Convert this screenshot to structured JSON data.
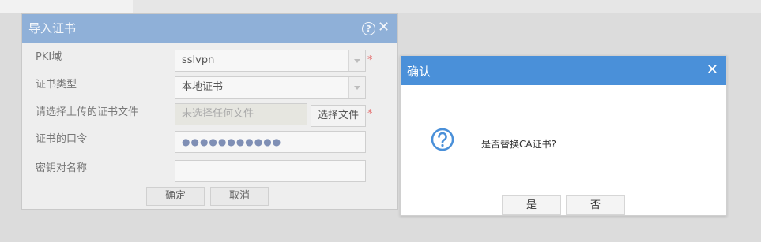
{
  "import_dialog": {
    "title": "导入证书",
    "help_icon": "question-circle-icon",
    "close_icon": "close-icon",
    "labels": {
      "pki_domain": "PKI域",
      "cert_type": "证书类型",
      "upload_file": "请选择上传的证书文件",
      "cert_password": "证书的口令",
      "key_pair_name": "密钥对名称"
    },
    "pki_domain_value": "sslvpn",
    "cert_type_value": "本地证书",
    "file_placeholder": "未选择任何文件",
    "choose_file_label": "选择文件",
    "password_mask": "●●●●●●●●●●●",
    "key_pair_value": "",
    "required_mark": "*",
    "ok_label": "确定",
    "cancel_label": "取消"
  },
  "confirm_dialog": {
    "title": "确认",
    "close_icon": "close-icon",
    "icon": "question-circle-icon",
    "message": "是否替换CA证书?",
    "yes_label": "是",
    "no_label": "否",
    "accent_color": "#4a90d9"
  }
}
